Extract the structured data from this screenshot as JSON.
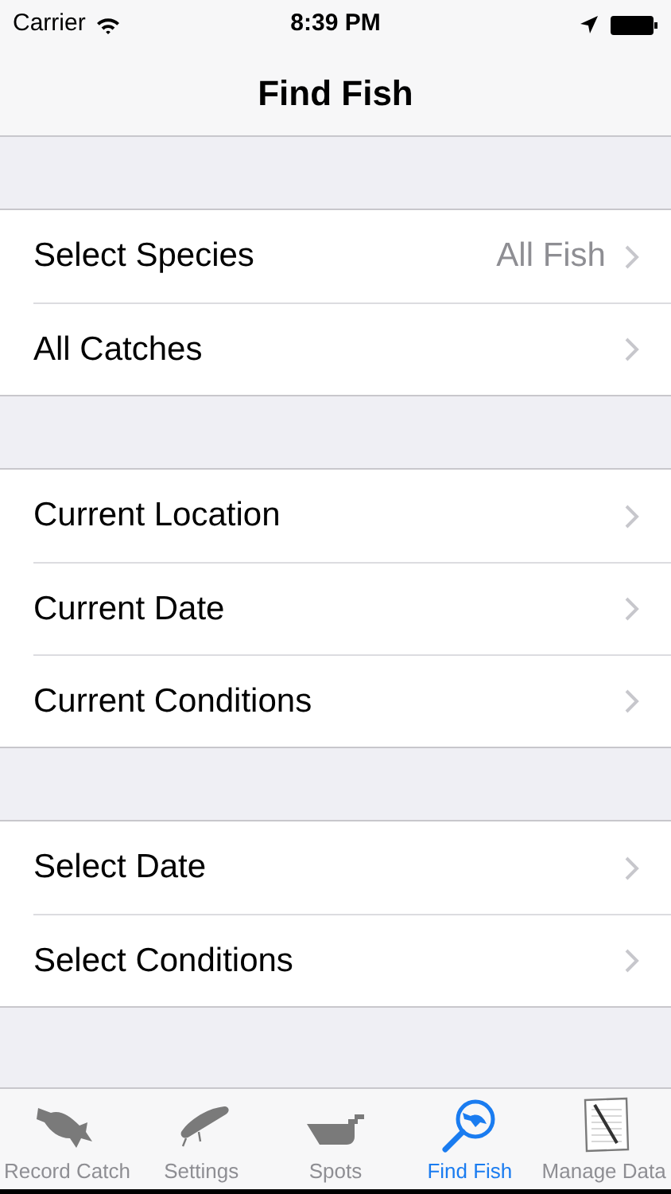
{
  "status_bar": {
    "carrier": "Carrier",
    "time": "8:39 PM"
  },
  "navigation_bar": {
    "title": "Find Fish"
  },
  "sections": [
    {
      "rows": [
        {
          "label": "Select Species",
          "value": "All Fish"
        },
        {
          "label": "All Catches"
        }
      ]
    },
    {
      "rows": [
        {
          "label": "Current Location"
        },
        {
          "label": "Current Date"
        },
        {
          "label": "Current Conditions"
        }
      ]
    },
    {
      "rows": [
        {
          "label": "Select Date"
        },
        {
          "label": "Select Conditions"
        }
      ]
    }
  ],
  "tab_bar": [
    {
      "label": "Record Catch",
      "selected": false
    },
    {
      "label": "Settings",
      "selected": false
    },
    {
      "label": "Spots",
      "selected": false
    },
    {
      "label": "Find Fish",
      "selected": true
    },
    {
      "label": "Manage Data",
      "selected": false
    }
  ]
}
